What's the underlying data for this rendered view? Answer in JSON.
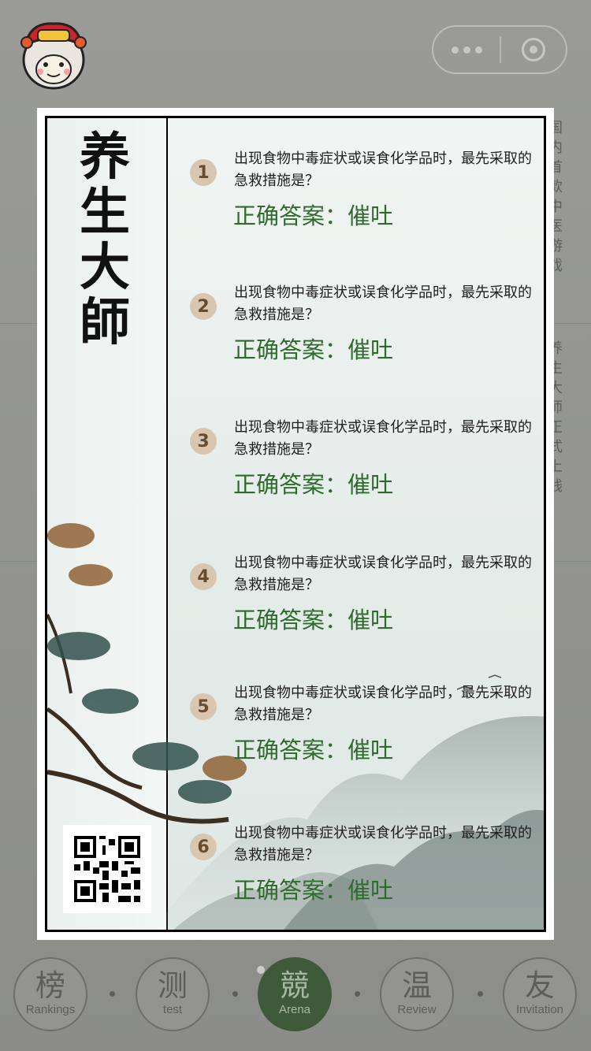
{
  "background": {
    "vertical_text_1": "国内首款中医游戏",
    "vertical_text_2": "养生大师正式上线"
  },
  "poster": {
    "brand": "养生大師",
    "questions": [
      {
        "number": "1",
        "question": "出现食物中毒症状或误食化学品时，最先采取的急救措施是？",
        "answer": "正确答案：催吐"
      },
      {
        "number": "2",
        "question": "出现食物中毒症状或误食化学品时，最先采取的急救措施是？",
        "answer": "正确答案：催吐"
      },
      {
        "number": "3",
        "question": "出现食物中毒症状或误食化学品时，最先采取的急救措施是？",
        "answer": "正确答案：催吐"
      },
      {
        "number": "4",
        "question": "出现食物中毒症状或误食化学品时，最先采取的急救措施是？",
        "answer": "正确答案：催吐"
      },
      {
        "number": "5",
        "question": "出现食物中毒症状或误食化学品时，最先采取的急救措施是？",
        "answer": "正确答案：催吐"
      },
      {
        "number": "6",
        "question": "出现食物中毒症状或误食化学品时，最先采取的急救措施是？",
        "answer": "正确答案：催吐"
      }
    ]
  },
  "pager": {
    "count": 4,
    "active": 1
  },
  "nav": {
    "items": [
      {
        "zh": "榜",
        "en": "Rankings"
      },
      {
        "zh": "测",
        "en": "test"
      },
      {
        "zh": "競",
        "en": "Arena"
      },
      {
        "zh": "温",
        "en": "Review"
      },
      {
        "zh": "友",
        "en": "Invitation"
      }
    ],
    "active_index": 2
  },
  "colors": {
    "answer_green": "#2f6b2c",
    "nav_active": "#3f5a3a",
    "number_badge": "#d8c6b1"
  },
  "icons": {
    "mascot": "lion-dance-mascot-icon",
    "capsule_more": "more-dots-icon",
    "capsule_close": "target-close-icon",
    "qr": "qr-code-icon"
  }
}
